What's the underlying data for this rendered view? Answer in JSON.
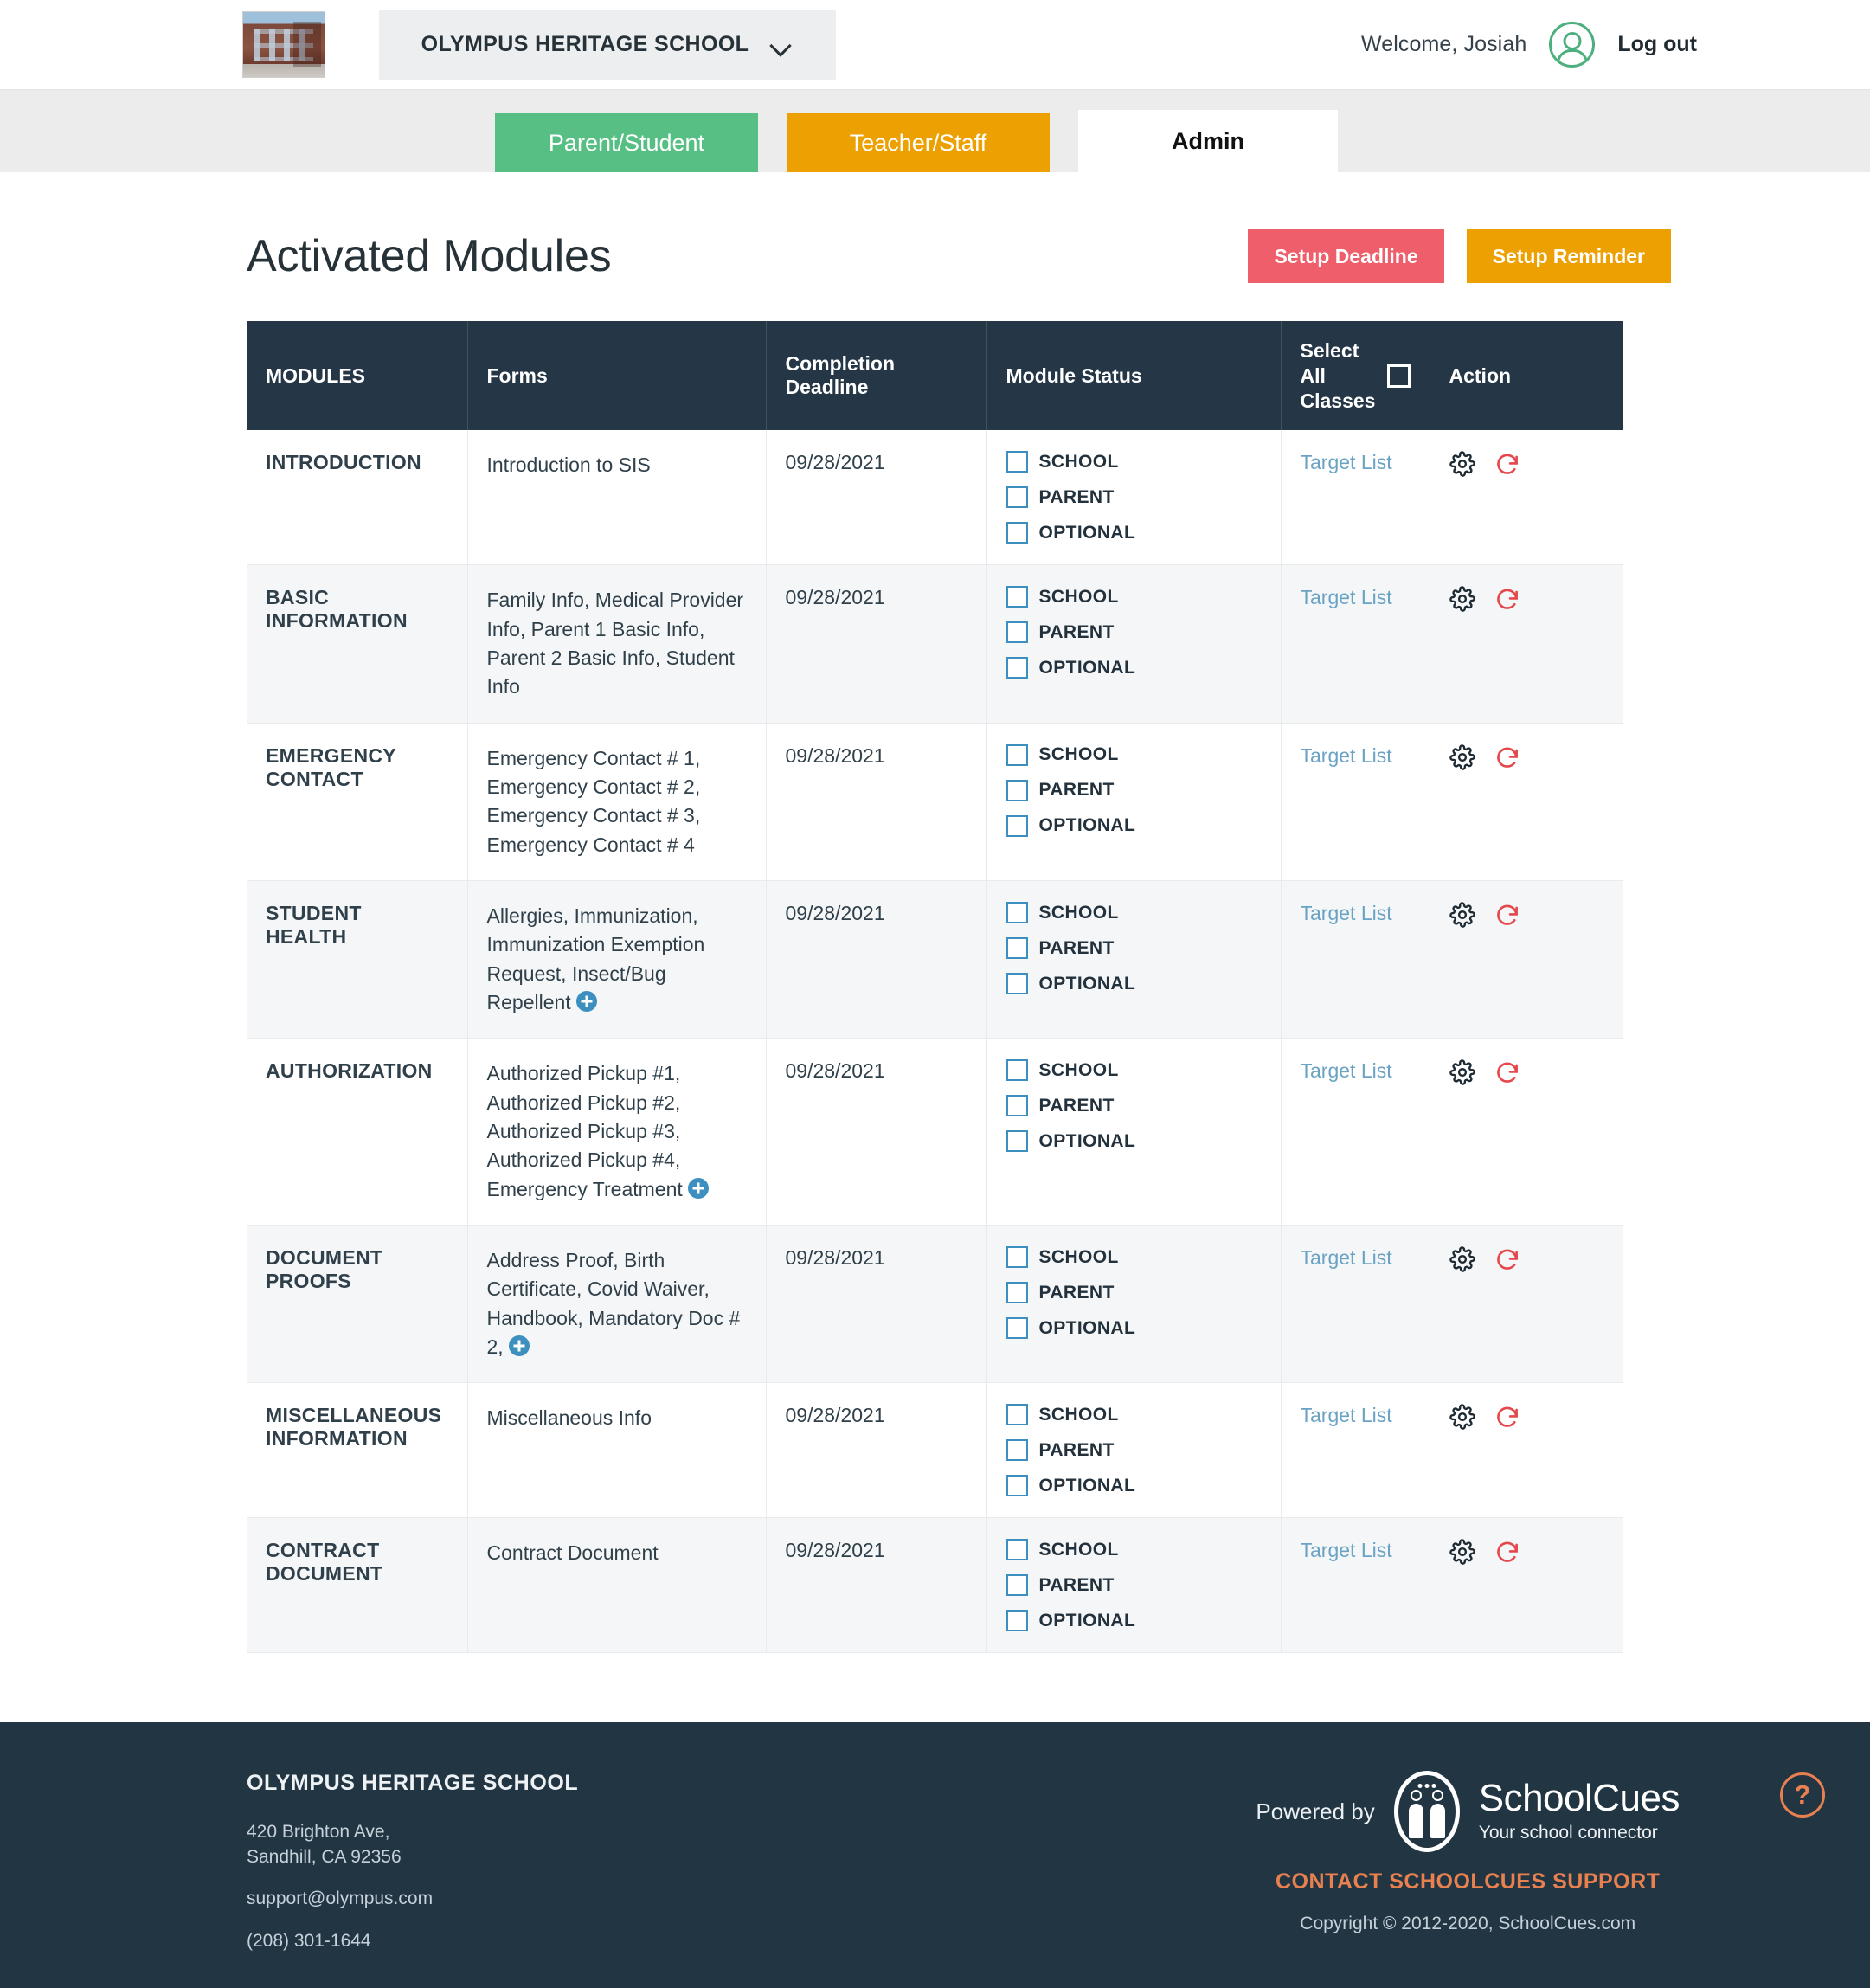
{
  "header": {
    "logo_icon": "school-building-photo",
    "school_name": "OLYMPUS HERITAGE SCHOOL",
    "dropdown_icon": "chevron-down-icon",
    "welcome_text": "Welcome, Josiah",
    "avatar_icon": "user-avatar-icon",
    "logout_label": "Log out"
  },
  "tabs": [
    {
      "label": "Parent/Student",
      "active": false,
      "color": "#57bf83"
    },
    {
      "label": "Teacher/Staff",
      "active": false,
      "color": "#eda001"
    },
    {
      "label": "Admin",
      "active": true,
      "color": "#ffffff"
    }
  ],
  "page": {
    "title": "Activated Modules",
    "setup_deadline_label": "Setup Deadline",
    "setup_reminder_label": "Setup Reminder",
    "deadline_color": "#ef5f6b",
    "reminder_color": "#eda001"
  },
  "table": {
    "headers": {
      "modules": "MODULES",
      "forms": "Forms",
      "deadline": "Completion Deadline",
      "status": "Module Status",
      "select_all": "Select All Classes",
      "action": "Action"
    },
    "status_options": {
      "school": "SCHOOL",
      "parent": "PARENT",
      "optional": "OPTIONAL"
    },
    "target_list_label": "Target List",
    "gear_icon": "gear-icon",
    "refresh_icon": "refresh-icon",
    "plus_icon": "plus-circle-icon",
    "rows": [
      {
        "module": "INTRODUCTION",
        "forms": "Introduction to SIS",
        "has_more": false,
        "deadline": "09/28/2021",
        "school_checked": false,
        "parent_checked": false,
        "optional_checked": false,
        "target": "Target List"
      },
      {
        "module": "BASIC INFORMATION",
        "forms": "Family Info, Medical Provider Info, Parent 1 Basic Info, Parent 2 Basic Info, Student Info",
        "has_more": false,
        "deadline": "09/28/2021",
        "school_checked": false,
        "parent_checked": false,
        "optional_checked": false,
        "target": "Target List"
      },
      {
        "module": "EMERGENCY CONTACT",
        "forms": "Emergency Contact # 1, Emergency Contact # 2, Emergency Contact # 3, Emergency Contact # 4",
        "has_more": false,
        "deadline": "09/28/2021",
        "school_checked": false,
        "parent_checked": false,
        "optional_checked": false,
        "target": "Target List"
      },
      {
        "module": "STUDENT HEALTH",
        "forms": "Allergies, Immunization, Immunization Exemption Request, Insect/Bug Repellent",
        "has_more": true,
        "deadline": "09/28/2021",
        "school_checked": false,
        "parent_checked": false,
        "optional_checked": false,
        "target": "Target List"
      },
      {
        "module": "AUTHORIZATION",
        "forms": "Authorized Pickup #1, Authorized Pickup #2, Authorized Pickup #3, Authorized Pickup #4, Emergency Treatment",
        "has_more": true,
        "deadline": "09/28/2021",
        "school_checked": false,
        "parent_checked": false,
        "optional_checked": false,
        "target": "Target List"
      },
      {
        "module": "DOCUMENT PROOFS",
        "forms": "Address Proof, Birth Certificate, Covid Waiver, Handbook, Mandatory Doc # 2,",
        "has_more": true,
        "deadline": "09/28/2021",
        "school_checked": false,
        "parent_checked": false,
        "optional_checked": false,
        "target": "Target List"
      },
      {
        "module": "MISCELLANEOUS INFORMATION",
        "forms": "Miscellaneous Info",
        "has_more": false,
        "deadline": "09/28/2021",
        "school_checked": false,
        "parent_checked": false,
        "optional_checked": false,
        "target": "Target List"
      },
      {
        "module": "CONTRACT DOCUMENT",
        "forms": "Contract Document",
        "has_more": false,
        "deadline": "09/28/2021",
        "school_checked": false,
        "parent_checked": false,
        "optional_checked": false,
        "target": "Target List"
      }
    ]
  },
  "footer": {
    "school_name": "OLYMPUS HERITAGE SCHOOL",
    "address_line1": "420 Brighton Ave,",
    "address_line2": "Sandhill, CA 92356",
    "email": "support@olympus.com",
    "phone": "(208) 301-1644",
    "powered_by": "Powered by",
    "brand_name": "SchoolCues",
    "brand_tagline": "Your school connector",
    "brand_icon": "schoolcues-logo-icon",
    "contact_support": "CONTACT SCHOOLCUES SUPPORT",
    "copyright": "Copyright © 2012-2020, SchoolCues.com",
    "help_icon": "question-mark-icon",
    "accent_color": "#e8804f",
    "background_color": "#223543"
  }
}
